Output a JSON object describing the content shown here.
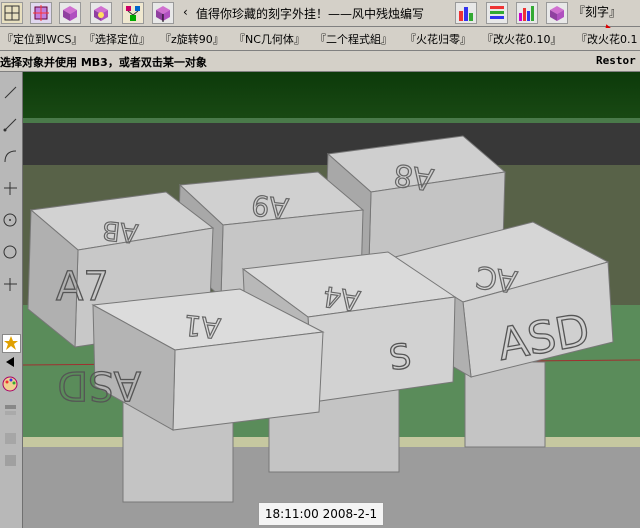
{
  "toolbar": {
    "marquee": "值得你珍藏的刻字外挂！——风中残烛编写",
    "carve_label": "『刻字』",
    "icons": [
      "grid-icon",
      "box-icon",
      "box-icon",
      "cube-icon",
      "tree-icon",
      "cube-icon",
      "histogram-icon",
      "lines-icon",
      "bar-chart-icon",
      "cube-icon"
    ]
  },
  "macros": [
    "『定位到WCS』",
    "『选择定位』",
    "『z旋转90』",
    "『NC几何体』",
    "『二个程式組』",
    "『火花归零』",
    "『改火花0.10』",
    "『改火花0.1"
  ],
  "prompt": {
    "text": "选择对象并使用 MB3，或者双击某一对象",
    "restore": "Restor"
  },
  "viewport": {
    "blocks": [
      {
        "back": "AB"
      },
      {
        "back": "A9"
      },
      {
        "back": "A8"
      },
      {
        "front": "A7"
      },
      {
        "top": "A1",
        "front": "ASD"
      },
      {
        "top": "A4",
        "side": "S"
      },
      {
        "top": "AC",
        "front": "ASD"
      }
    ]
  },
  "status": {
    "timestamp": "18:11:00 2008-2-1"
  }
}
